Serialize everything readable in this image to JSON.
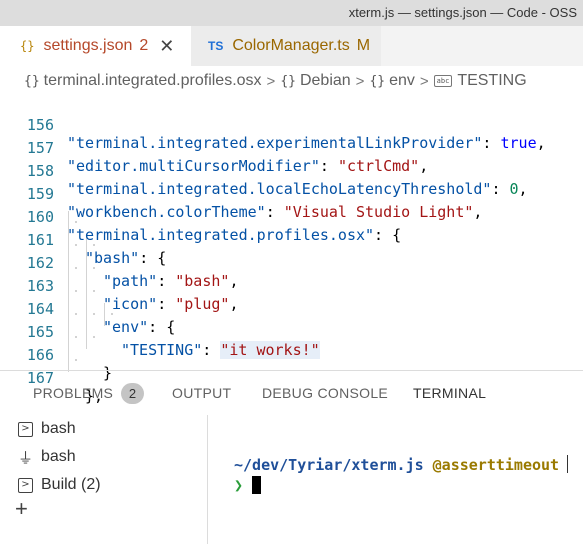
{
  "window": {
    "title": "xterm.js — settings.json — Code - OSS"
  },
  "tabs": [
    {
      "icon": "{}",
      "label": "settings.json",
      "badge": "2",
      "close": "✕"
    },
    {
      "icon": "TS",
      "label": "ColorManager.ts",
      "badge": "M"
    }
  ],
  "breadcrumb": {
    "items": [
      {
        "icon": "{}",
        "label": "terminal.integrated.profiles.osx"
      },
      {
        "icon": "{}",
        "label": "Debian"
      },
      {
        "icon": "{}",
        "label": "env"
      },
      {
        "icon": "abc",
        "label": "TESTING"
      }
    ],
    "separator": ">"
  },
  "editor": {
    "lines": [
      {
        "num": "156",
        "k": "\"terminal.integrated.experimentalLinkProvider\"",
        "colon": ": ",
        "v": "true",
        "vt": "b",
        "end": ","
      },
      {
        "num": "157",
        "k": "\"editor.multiCursorModifier\"",
        "colon": ": ",
        "v": "\"ctrlCmd\"",
        "vt": "s",
        "end": ","
      },
      {
        "num": "158",
        "k": "\"terminal.integrated.localEchoLatencyThreshold\"",
        "colon": ": ",
        "v": "0",
        "vt": "n",
        "end": ","
      },
      {
        "num": "159",
        "k": "\"workbench.colorTheme\"",
        "colon": ": ",
        "v": "\"Visual Studio Light\"",
        "vt": "s",
        "end": ","
      },
      {
        "num": "160",
        "k": "\"terminal.integrated.profiles.osx\"",
        "colon": ": ",
        "v": "{",
        "vt": "p",
        "end": ""
      },
      {
        "num": "161",
        "k": "\"bash\"",
        "colon": ": ",
        "v": "{",
        "vt": "p",
        "end": ""
      },
      {
        "num": "162",
        "k": "\"path\"",
        "colon": ": ",
        "v": "\"bash\"",
        "vt": "s",
        "end": ","
      },
      {
        "num": "163",
        "k": "\"icon\"",
        "colon": ": ",
        "v": "\"plug\"",
        "vt": "s",
        "end": ","
      },
      {
        "num": "164",
        "k": "\"env\"",
        "colon": ": ",
        "v": "{",
        "vt": "p",
        "end": ""
      },
      {
        "num": "165",
        "k": "\"TESTING\"",
        "colon": ": ",
        "v": "\"it works!\"",
        "vt": "s",
        "end": ""
      },
      {
        "num": "166",
        "k": "",
        "colon": "",
        "v": "}",
        "vt": "p",
        "end": ""
      },
      {
        "num": "167",
        "k": "",
        "colon": "",
        "v": "}",
        "vt": "p",
        "end": ","
      }
    ]
  },
  "panel": {
    "tabs": [
      {
        "label": "PROBLEMS",
        "active": false
      },
      {
        "label": "OUTPUT",
        "active": false
      },
      {
        "label": "DEBUG CONSOLE",
        "active": false
      },
      {
        "label": "TERMINAL",
        "active": true
      }
    ],
    "problems_count": "2"
  },
  "terminal_list": {
    "items": [
      {
        "icon": "terminal-icon",
        "label": "bash"
      },
      {
        "icon": "plug-icon",
        "label": "bash"
      },
      {
        "icon": "terminal-icon",
        "label": "Build (2)"
      }
    ],
    "add_icon": "plus-icon"
  },
  "terminal": {
    "path": "~/dev/Tyriar/xterm.js",
    "branch": "@asserttimeout",
    "prompt": "❯"
  },
  "colors": {
    "string": "#a31515",
    "key": "#0451a5",
    "keyword": "#0000ff",
    "number": "#098658",
    "line_number": "#237893",
    "terminal_path": "#1f4f99",
    "terminal_branch": "#9a7a00",
    "terminal_prompt": "#2a9d3a"
  }
}
